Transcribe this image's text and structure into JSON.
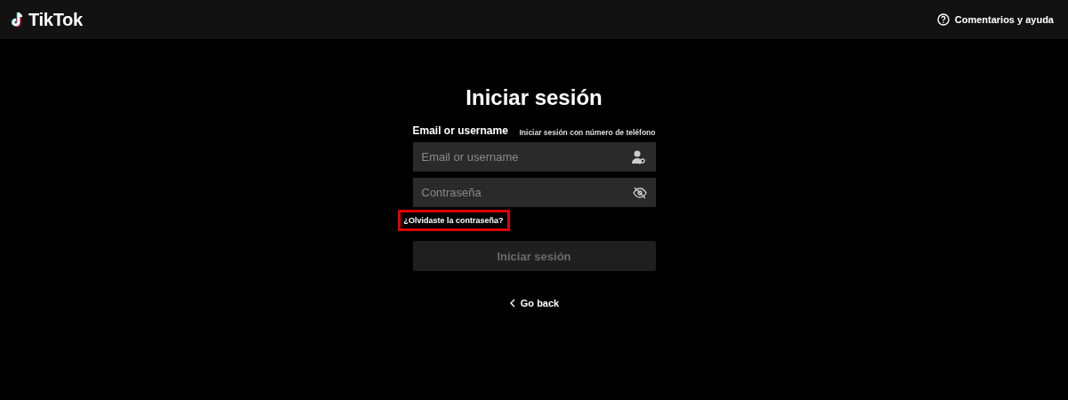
{
  "header": {
    "logo": "TikTok",
    "help_link": "Comentarios y ayuda"
  },
  "login": {
    "title": "Iniciar sesión",
    "field_label": "Email or username",
    "alt_link": "Iniciar sesión con número de teléfono",
    "username_field": {
      "placeholder": "Email or username"
    },
    "password_field": {
      "placeholder": "Contraseña"
    },
    "forgot_link": {
      "text": "¿Olvidaste la contraseña?",
      "highlighted": true
    },
    "submit_button": {
      "label": "Iniciar sesión",
      "disabled": true
    },
    "back_link": "Go back"
  }
}
